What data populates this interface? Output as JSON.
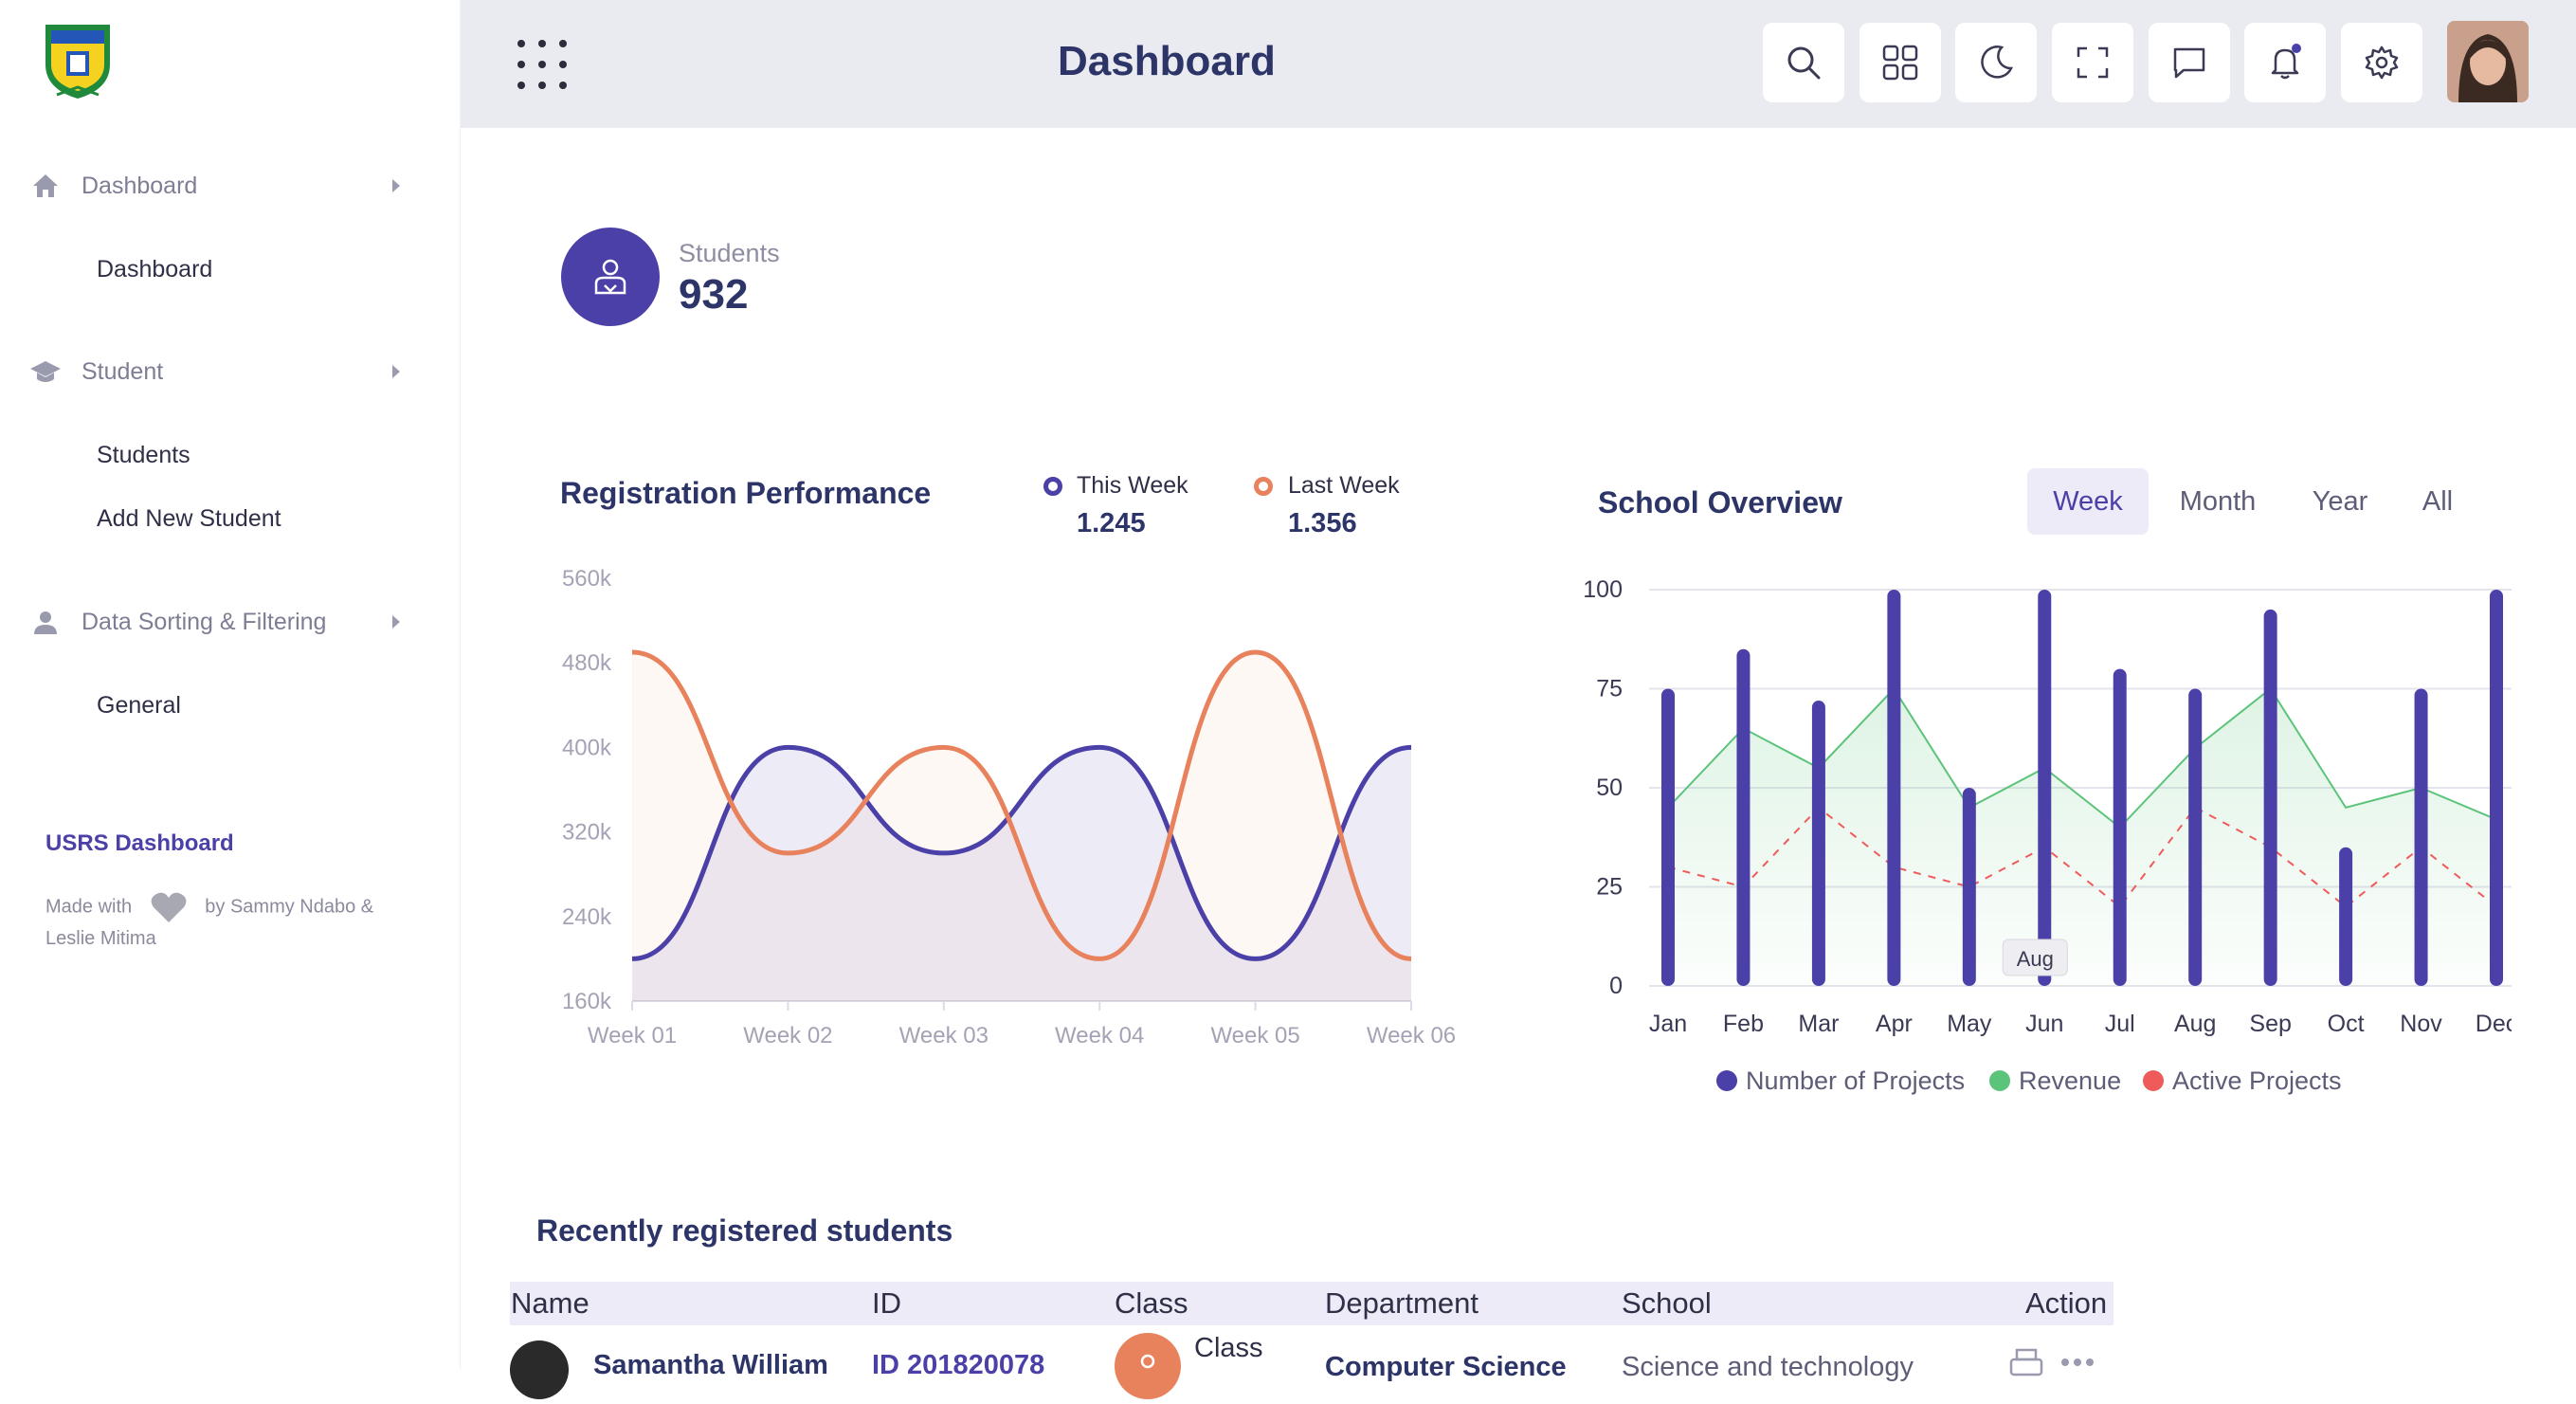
{
  "header": {
    "title": "Dashboard"
  },
  "sidebar": {
    "groups": [
      {
        "label": "Dashboard",
        "items": [
          "Dashboard"
        ]
      },
      {
        "label": "Student",
        "items": [
          "Students",
          "Add New Student"
        ]
      },
      {
        "label": "Data Sorting & Filtering",
        "items": [
          "General"
        ]
      }
    ],
    "footer_title": "USRS Dashboard",
    "footer_made_with": "Made with",
    "footer_by": "by Sammy Ndabo & Leslie Mitima"
  },
  "stats": {
    "label": "Students",
    "value": "932"
  },
  "registration": {
    "title": "Registration Performance",
    "this_week_label": "This Week",
    "this_week_value": "1.245",
    "last_week_label": "Last Week",
    "last_week_value": "1.356"
  },
  "overview": {
    "title": "School Overview",
    "periods": [
      "Week",
      "Month",
      "Year",
      "All"
    ],
    "active_period": "Week",
    "tooltip": "Aug"
  },
  "colors": {
    "accent": "#4a40a8",
    "orange": "#e8825c",
    "green": "#5cc47a",
    "red": "#ef5b5b"
  },
  "chart_data": [
    {
      "type": "line",
      "title": "Registration Performance",
      "categories": [
        "Week 01",
        "Week 02",
        "Week 03",
        "Week 04",
        "Week 05",
        "Week 06"
      ],
      "y_ticks": [
        "160k",
        "240k",
        "320k",
        "400k",
        "480k",
        "560k"
      ],
      "ylim": [
        160,
        560
      ],
      "series": [
        {
          "name": "This Week",
          "values": [
            200,
            400,
            300,
            400,
            200,
            400
          ]
        },
        {
          "name": "Last Week",
          "values": [
            490,
            300,
            400,
            200,
            490,
            200
          ]
        }
      ]
    },
    {
      "type": "bar",
      "title": "School Overview",
      "categories": [
        "Jan",
        "Feb",
        "Mar",
        "Apr",
        "May",
        "Jun",
        "Jul",
        "Aug",
        "Sep",
        "Oct",
        "Nov",
        "Dec"
      ],
      "y_ticks": [
        "0",
        "25",
        "50",
        "75",
        "100"
      ],
      "ylim": [
        0,
        100
      ],
      "series": [
        {
          "name": "Number of Projects",
          "type": "bar",
          "values": [
            75,
            85,
            72,
            100,
            50,
            100,
            80,
            75,
            95,
            35,
            75,
            100
          ]
        },
        {
          "name": "Revenue",
          "type": "area",
          "values": [
            45,
            65,
            55,
            75,
            45,
            55,
            40,
            60,
            75,
            45,
            50,
            42
          ]
        },
        {
          "name": "Active Projects",
          "type": "line-dashed",
          "values": [
            30,
            25,
            45,
            30,
            25,
            35,
            20,
            45,
            35,
            20,
            35,
            20
          ]
        }
      ]
    }
  ],
  "table": {
    "title": "Recently registered students",
    "columns": [
      "Name",
      "ID",
      "Class",
      "Department",
      "School",
      "Action"
    ],
    "rows": [
      {
        "name": "Samantha William",
        "id": "ID 201820078",
        "class": "Class",
        "department": "Computer Science",
        "school": "Science and technology"
      }
    ]
  }
}
